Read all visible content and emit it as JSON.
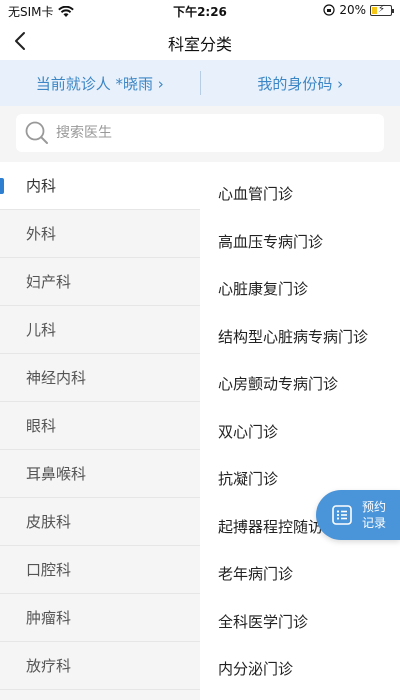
{
  "status_bar": {
    "carrier": "无SIM卡",
    "time": "下午2:26",
    "battery": "20%"
  },
  "nav": {
    "title": "科室分类"
  },
  "patient_bar": {
    "current_patient": "当前就诊人 *晓雨 ›",
    "my_id_code": "我的身份码 ›"
  },
  "search": {
    "placeholder": "搜索医生"
  },
  "departments": [
    "内科",
    "外科",
    "妇产科",
    "儿科",
    "神经内科",
    "眼科",
    "耳鼻喉科",
    "皮肤科",
    "口腔科",
    "肿瘤科",
    "放疗科"
  ],
  "active_department": "内科",
  "clinics": [
    "心血管门诊",
    "高血压专病门诊",
    "心脏康复门诊",
    "结构型心脏病专病门诊",
    "心房颤动专病门诊",
    "双心门诊",
    "抗凝门诊",
    "起搏器程控随访门诊",
    "老年病门诊",
    "全科医学门诊",
    "内分泌门诊"
  ],
  "float_button": {
    "line1": "预约",
    "line2": "记录"
  },
  "colors": {
    "accent": "#2f7fd0",
    "patient_bar_bg": "#e8f1fb",
    "patient_bar_text": "#3d86c6",
    "float_button_bg": "#4a94d9"
  }
}
